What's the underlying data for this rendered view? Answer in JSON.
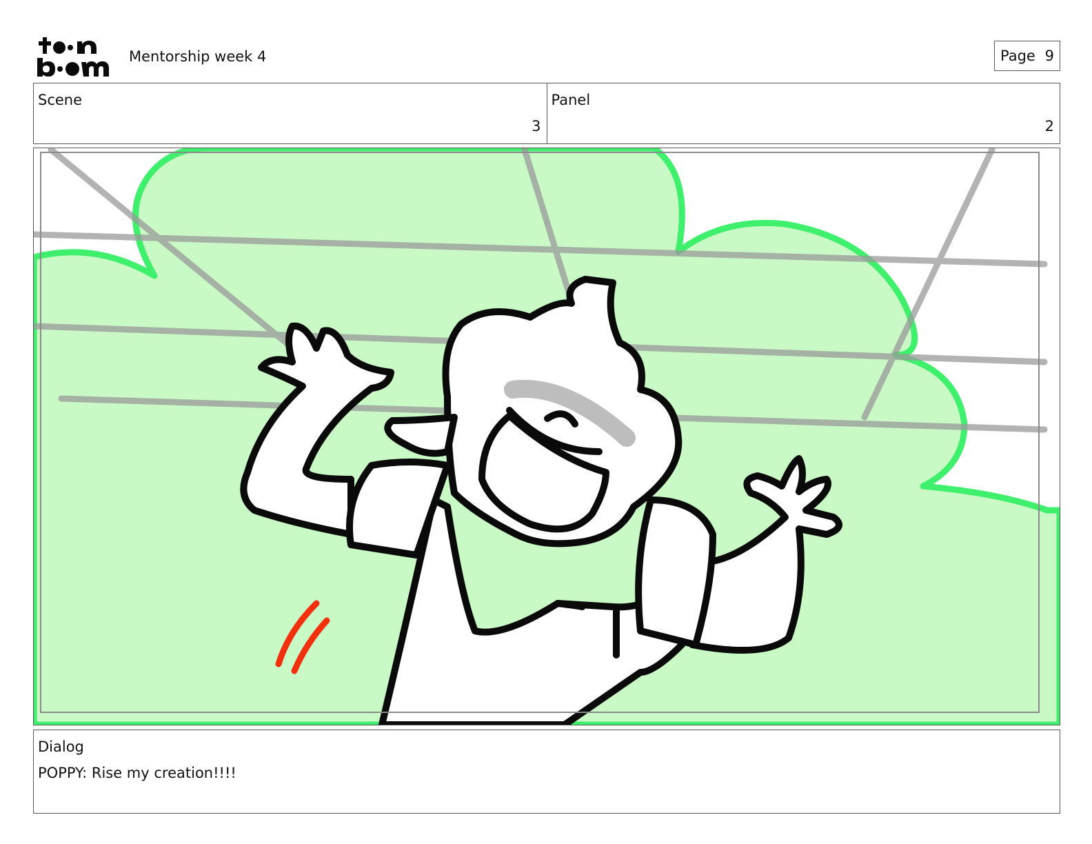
{
  "header": {
    "logo": {
      "name": "toon-boom-logo",
      "text_top": "toon",
      "text_bottom": "boom"
    },
    "title": "Mentorship week 4",
    "page_label": "Page",
    "page_number": "9"
  },
  "meta": {
    "scene_label": "Scene",
    "scene_value": "3",
    "panel_label": "Panel",
    "panel_value": "2"
  },
  "panel_art": {
    "description_icon": "storyboard-drawing",
    "colors": {
      "bush_fill": "#c9f9c5",
      "bush_outline": "#3ef06b",
      "ink": "#0a0a0a",
      "grid_lines": "#9a9a9a",
      "motion_marks": "#f2300e"
    }
  },
  "dialog": {
    "label": "Dialog",
    "text": "POPPY: Rise my creation!!!!"
  }
}
